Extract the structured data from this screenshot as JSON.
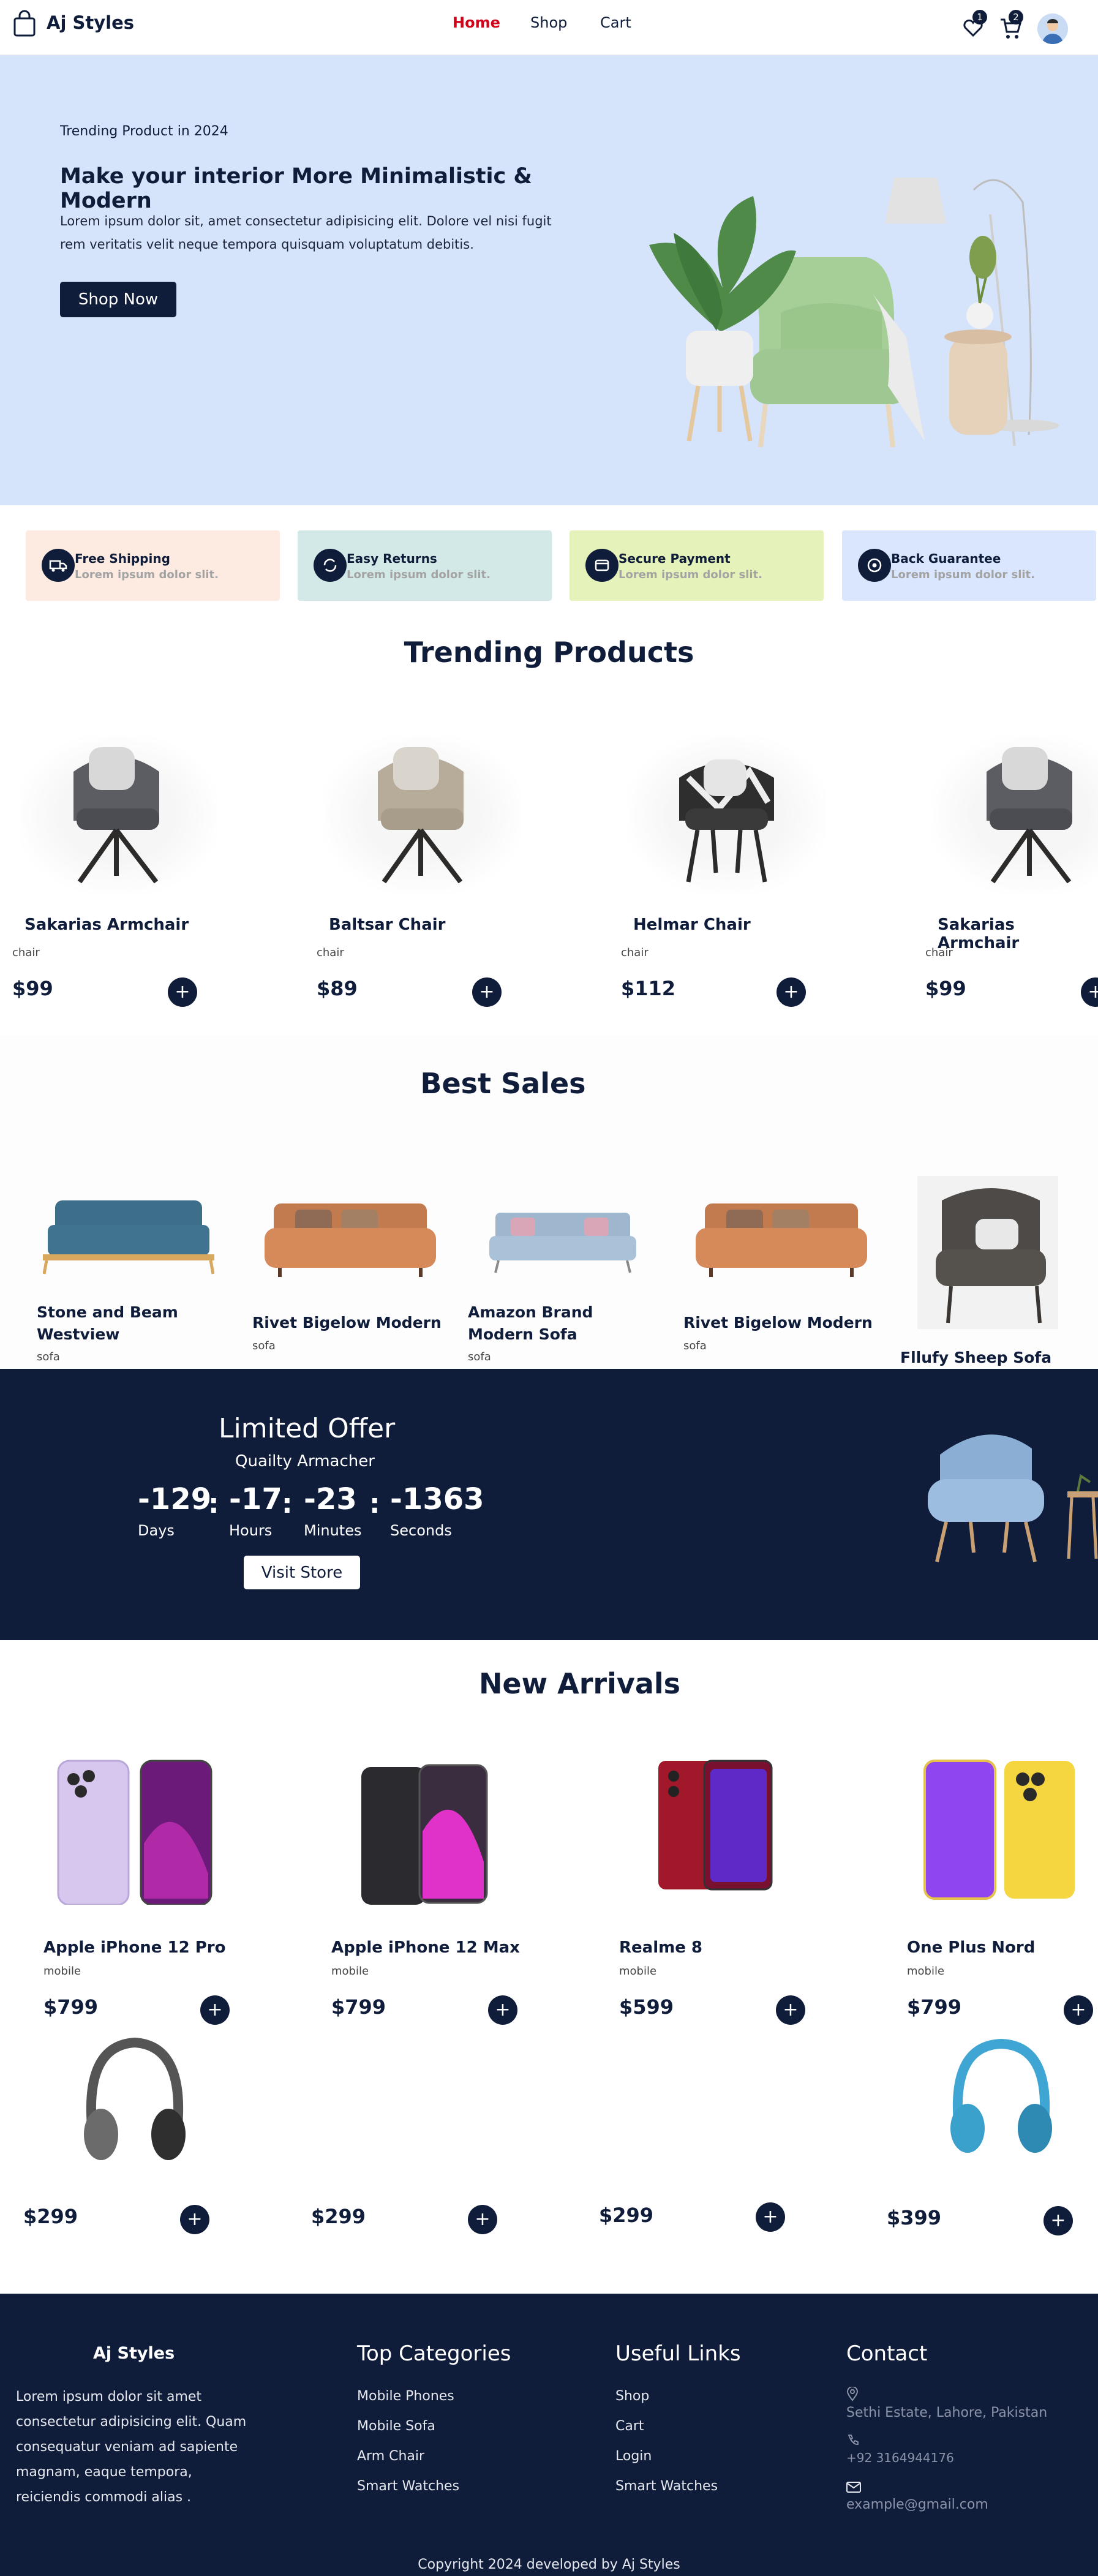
{
  "header": {
    "brand": "Aj Styles",
    "nav": [
      "Home",
      "Shop",
      "Cart"
    ],
    "wishlist_count": "1",
    "cart_count": "2"
  },
  "hero": {
    "eyebrow": "Trending Product in 2024",
    "title": "Make your interior More Minimalistic & Modern",
    "body": "Lorem ipsum dolor sit, amet consectetur adipisicing elit. Dolore vel nisi fugit rem veritatis velit neque tempora quisquam voluptatum debitis.",
    "cta": "Shop Now"
  },
  "features": [
    {
      "title": "Free Shipping",
      "sub": "Lorem ipsum dolor slit.",
      "bg": "#fdebe2"
    },
    {
      "title": "Easy Returns",
      "sub": "Lorem ipsum dolor slit.",
      "bg": "#d3e9e8"
    },
    {
      "title": "Secure Payment",
      "sub": "Lorem ipsum dolor slit.",
      "bg": "#e5f2b9"
    },
    {
      "title": "Back Guarantee",
      "sub": "Lorem ipsum dolor slit.",
      "bg": "#d9e6fd"
    }
  ],
  "trending": {
    "title": "Trending Products",
    "items": [
      {
        "name": "Sakarias Armchair",
        "cat": "chair",
        "price": "$99"
      },
      {
        "name": "Baltsar Chair",
        "cat": "chair",
        "price": "$89"
      },
      {
        "name": "Helmar Chair",
        "cat": "chair",
        "price": "$112"
      },
      {
        "name": "Sakarias Armchair",
        "cat": "chair",
        "price": "$99"
      }
    ]
  },
  "best_sales": {
    "title": "Best Sales",
    "items": [
      {
        "name": "Stone and Beam Westview",
        "cat": "sofa"
      },
      {
        "name": "Rivet Bigelow Modern",
        "cat": "sofa"
      },
      {
        "name": "Amazon Brand Modern Sofa",
        "cat": "sofa"
      },
      {
        "name": "Rivet Bigelow Modern",
        "cat": "sofa"
      },
      {
        "name": "Fllufy Sheep Sofa",
        "cat": ""
      }
    ]
  },
  "offer": {
    "title": "Limited Offer",
    "subtitle": "Quailty Armacher",
    "days": "-129",
    "hours": "-17",
    "minutes": "-23",
    "seconds": "-1363",
    "days_label": "Days",
    "hours_label": "Hours",
    "minutes_label": "Minutes",
    "seconds_label": "Seconds",
    "cta": "Visit Store"
  },
  "arrivals": {
    "title": "New Arrivals",
    "items": [
      {
        "name": "Apple iPhone 12 Pro",
        "cat": "mobile",
        "price": "$799"
      },
      {
        "name": "Apple iPhone 12 Max",
        "cat": "mobile",
        "price": "$799"
      },
      {
        "name": "Realme 8",
        "cat": "mobile",
        "price": "$599"
      },
      {
        "name": "One Plus Nord",
        "cat": "mobile",
        "price": "$799"
      }
    ],
    "row2": [
      {
        "price": "$299"
      },
      {
        "price": "$299"
      },
      {
        "price": "$299"
      },
      {
        "price": "$399"
      }
    ]
  },
  "footer": {
    "brand": "Aj Styles",
    "about": "Lorem ipsum dolor sit amet consectetur adipisicing elit. Quam consequatur veniam ad sapiente magnam, eaque tempora, reiciendis commodi alias .",
    "categories_title": "Top Categories",
    "categories": [
      "Mobile Phones",
      "Mobile Sofa",
      "Arm Chair",
      "Smart Watches"
    ],
    "links_title": "Useful Links",
    "links": [
      "Shop",
      "Cart",
      "Login",
      "Smart Watches"
    ],
    "contact_title": "Contact",
    "address": "Sethi Estate, Lahore, Pakistan",
    "phone": "+92 3164944176",
    "email": "example@gmail.com",
    "copyright": "Copyright 2024 developed by Aj Styles"
  },
  "colors": {
    "navy": "#0f1c3a",
    "hero_bg": "#d6e4fb",
    "nav_active": "#d0021b"
  }
}
